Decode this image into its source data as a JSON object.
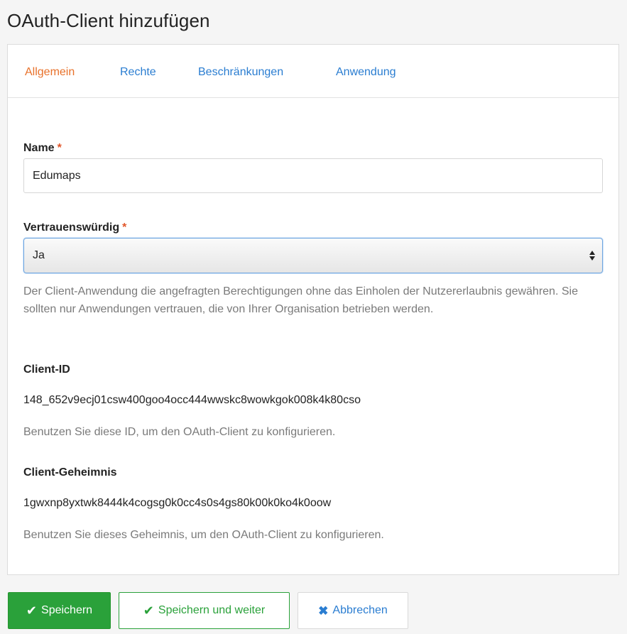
{
  "page": {
    "title": "OAuth-Client hinzufügen"
  },
  "tabs": [
    {
      "label": "Allgemein",
      "active": true
    },
    {
      "label": "Rechte",
      "active": false
    },
    {
      "label": "Beschränkungen",
      "active": false
    },
    {
      "label": "Anwendung",
      "active": false
    }
  ],
  "form": {
    "name": {
      "label": "Name",
      "required_mark": "*",
      "value": "Edumaps"
    },
    "trusted": {
      "label": "Vertrauenswürdig",
      "required_mark": "*",
      "selected": "Ja",
      "help": "Der Client-Anwendung die angefragten Berechtigungen ohne das Einholen der Nutzererlaubnis gewähren. Sie sollten nur Anwendungen vertrauen, die von Ihrer Organisation betrieben werden."
    },
    "client_id": {
      "label": "Client-ID",
      "value": "148_652v9ecj01csw400goo4occ444wwskc8wowkgok008k4k80cso",
      "help": "Benutzen Sie diese ID, um den OAuth-Client zu konfigurieren."
    },
    "client_secret": {
      "label": "Client-Geheimnis",
      "value": "1gwxnp8yxtwk8444k4cogsg0k0cc4s0s4gs80k00k0ko4k0oow",
      "help": "Benutzen Sie dieses Geheimnis, um den OAuth-Client zu konfigurieren."
    }
  },
  "actions": {
    "save": "Speichern",
    "save_continue": "Speichern und weiter",
    "cancel": "Abbrechen"
  },
  "icons": {
    "save": "check-icon",
    "save_continue": "check-icon",
    "cancel": "x-icon",
    "select": "sort-arrows-icon"
  },
  "colors": {
    "accent_active_tab": "#e8712a",
    "link": "#2a7dd1",
    "primary_green": "#2aa13a",
    "required": "#e1562a"
  }
}
